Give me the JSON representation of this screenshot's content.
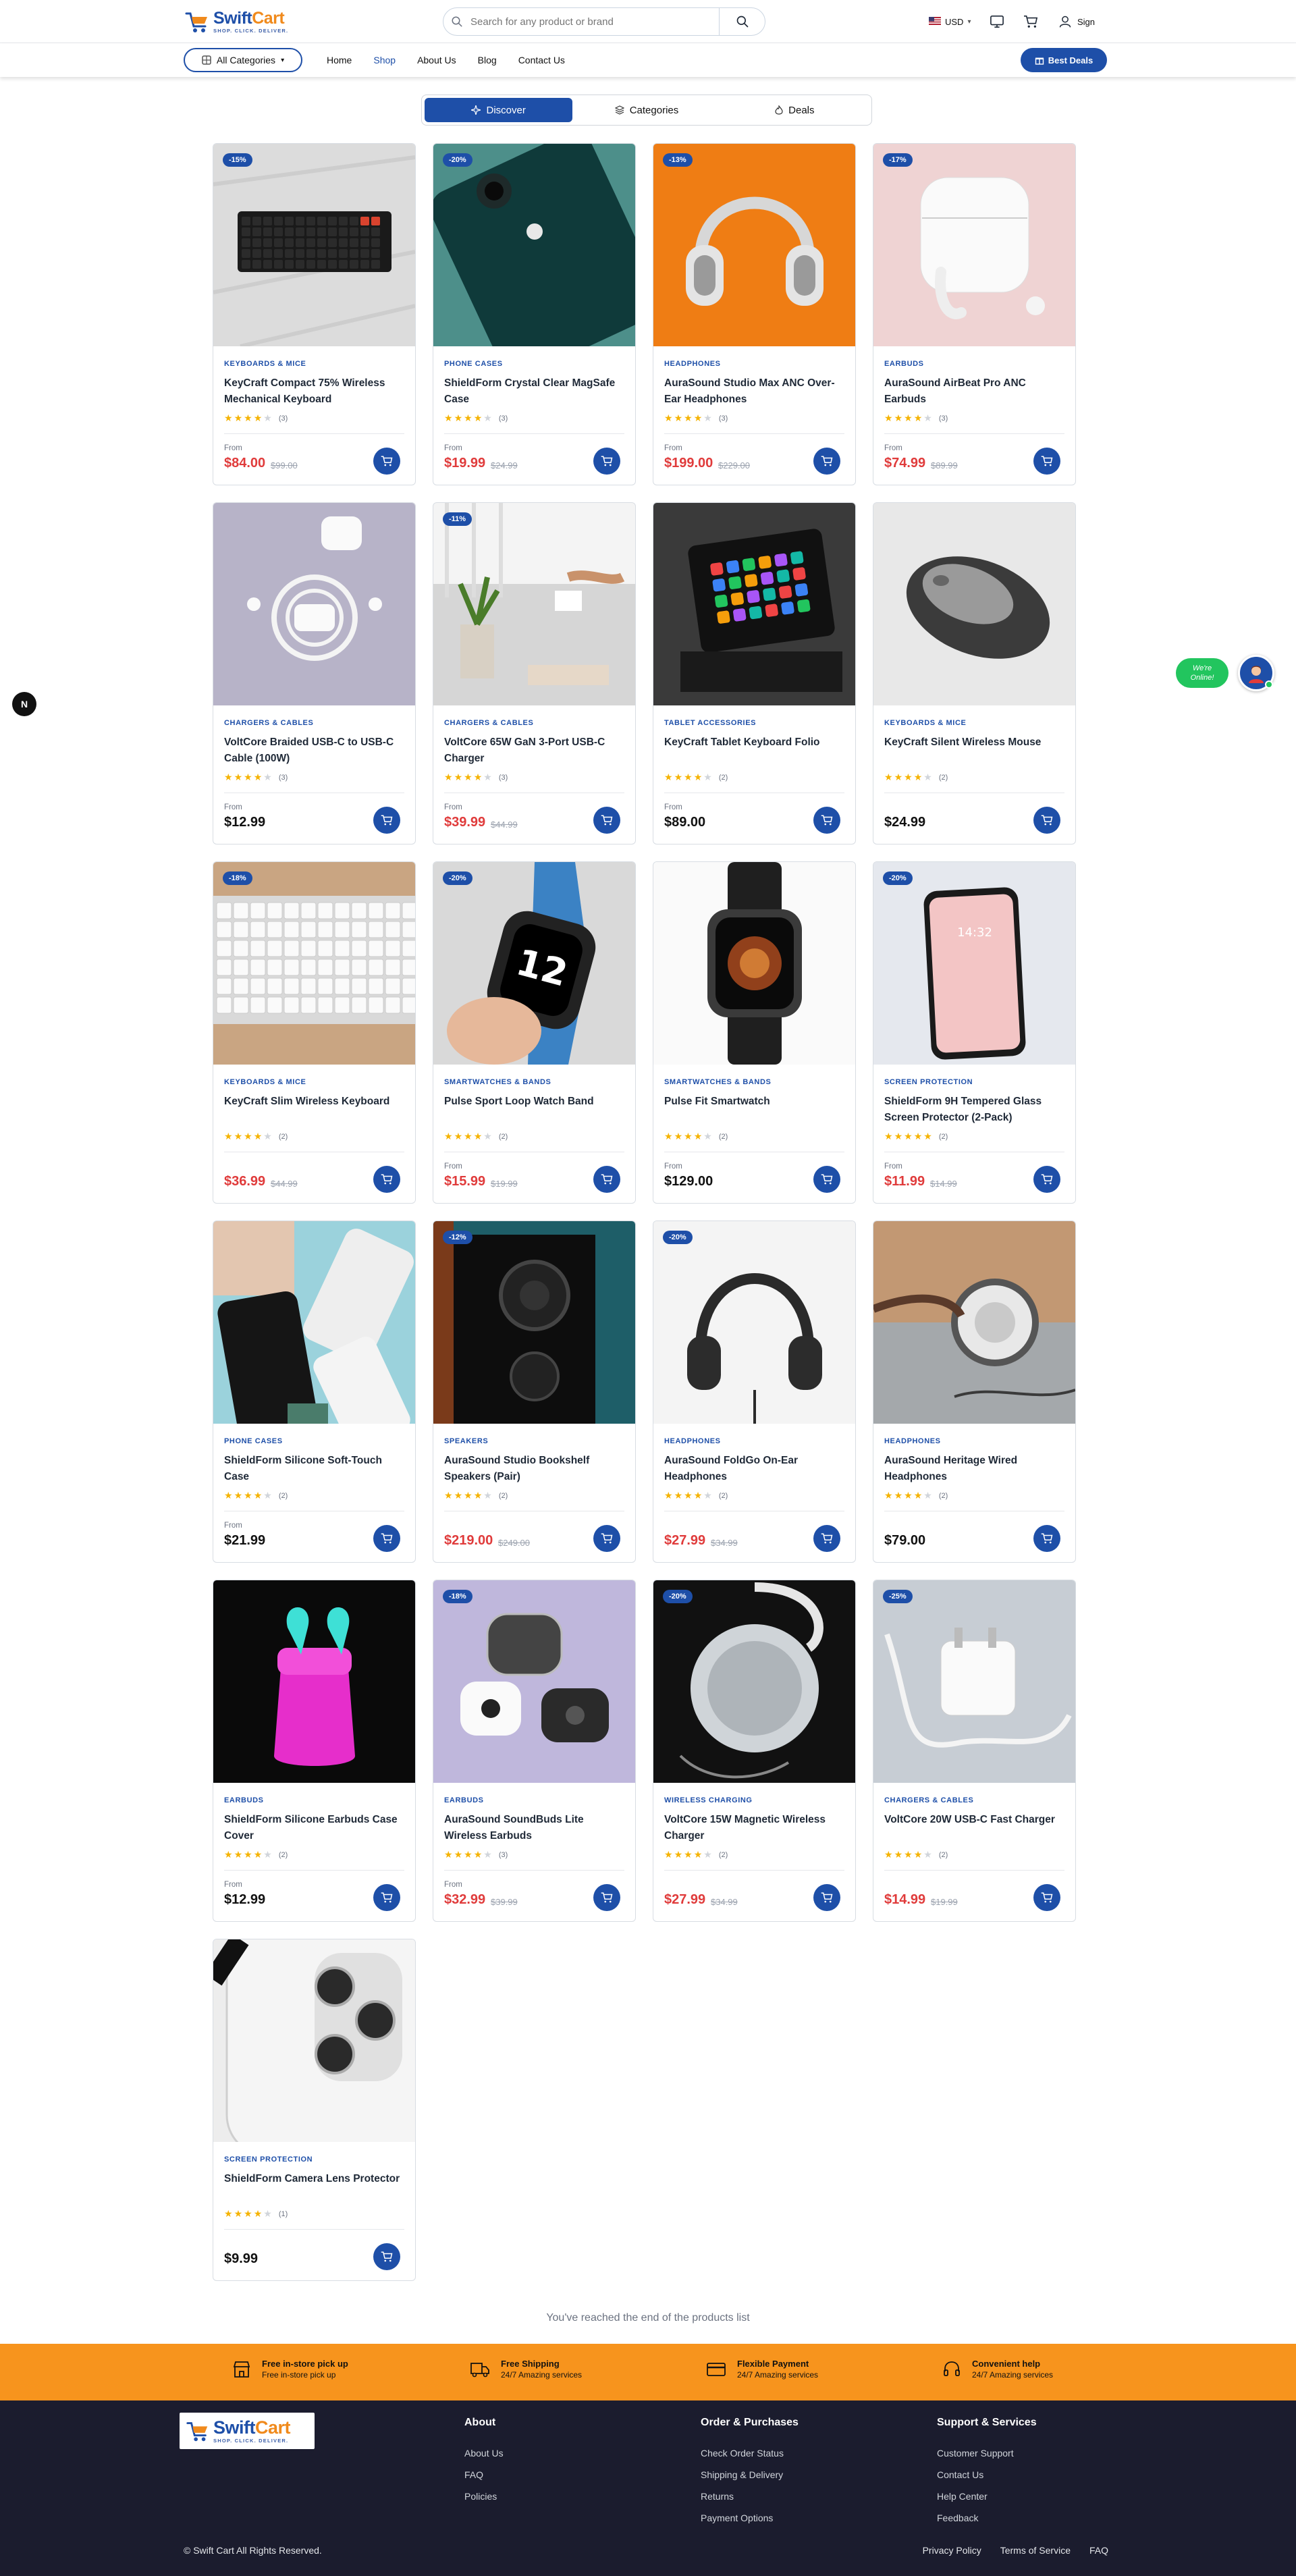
{
  "brand": {
    "name_part1": "Swift",
    "name_part2": "Cart",
    "tagline": "SHOP. CLICK. DELIVER."
  },
  "search": {
    "placeholder": "Search for any product or brand"
  },
  "header": {
    "currency": "USD",
    "sign_label": "Sign"
  },
  "nav": {
    "all_categories": "All Categories",
    "links": [
      "Home",
      "Shop",
      "About Us",
      "Blog",
      "Contact Us"
    ],
    "active": "Shop",
    "best_deals": "Best Deals"
  },
  "tabs": [
    "Discover",
    "Categories",
    "Deals"
  ],
  "products": [
    {
      "badge": "-15%",
      "category": "KEYBOARDS & MICE",
      "name": "KeyCraft Compact 75% Wireless Mechanical Keyboard",
      "rating": 4,
      "reviews": "(3)",
      "from": "From",
      "price": "$84.00",
      "old": "$99.00",
      "image": "keyboard-compact"
    },
    {
      "badge": "-20%",
      "category": "PHONE CASES",
      "name": "ShieldForm Crystal Clear MagSafe Case",
      "rating": 4,
      "reviews": "(3)",
      "from": "From",
      "price": "$19.99",
      "old": "$24.99",
      "image": "phone-case-green"
    },
    {
      "badge": "-13%",
      "category": "HEADPHONES",
      "name": "AuraSound Studio Max ANC Over-Ear Headphones",
      "rating": 4,
      "reviews": "(3)",
      "from": "From",
      "price": "$199.00",
      "old": "$229.00",
      "image": "headphones-orange"
    },
    {
      "badge": "-17%",
      "category": "EARBUDS",
      "name": "AuraSound AirBeat Pro ANC Earbuds",
      "rating": 4,
      "reviews": "(3)",
      "from": "From",
      "price": "$74.99",
      "old": "$89.99",
      "image": "earbuds-pink"
    },
    {
      "badge": "",
      "category": "CHARGERS & CABLES",
      "name": "VoltCore Braided USB-C to USB-C Cable (100W)",
      "rating": 4,
      "reviews": "(3)",
      "from": "From",
      "price": "$12.99",
      "old": "",
      "image": "cable-lavender"
    },
    {
      "badge": "-11%",
      "category": "CHARGERS & CABLES",
      "name": "VoltCore 65W GaN 3-Port USB-C Charger",
      "rating": 4,
      "reviews": "(3)",
      "from": "From",
      "price": "$39.99",
      "old": "$44.99",
      "image": "charger-desk"
    },
    {
      "badge": "",
      "category": "TABLET ACCESSORIES",
      "name": "KeyCraft Tablet Keyboard Folio",
      "rating": 4,
      "reviews": "(2)",
      "from": "From",
      "price": "$89.00",
      "old": "",
      "image": "tablet"
    },
    {
      "badge": "",
      "category": "KEYBOARDS & MICE",
      "name": "KeyCraft Silent Wireless Mouse",
      "rating": 4,
      "reviews": "(2)",
      "from": "",
      "price": "$24.99",
      "old": "",
      "image": "mouse"
    },
    {
      "badge": "-18%",
      "category": "KEYBOARDS & MICE",
      "name": "KeyCraft Slim Wireless Keyboard",
      "rating": 4,
      "reviews": "(2)",
      "from": "",
      "price": "$36.99",
      "old": "$44.99",
      "image": "keyboard-slim"
    },
    {
      "badge": "-20%",
      "category": "SMARTWATCHES & BANDS",
      "name": "Pulse Sport Loop Watch Band",
      "rating": 4,
      "reviews": "(2)",
      "from": "From",
      "price": "$15.99",
      "old": "$19.99",
      "image": "watch-band"
    },
    {
      "badge": "",
      "category": "SMARTWATCHES & BANDS",
      "name": "Pulse Fit Smartwatch",
      "rating": 4,
      "reviews": "(2)",
      "from": "From",
      "price": "$129.00",
      "old": "",
      "image": "smartwatch"
    },
    {
      "badge": "-20%",
      "category": "SCREEN PROTECTION",
      "name": "ShieldForm 9H Tempered Glass Screen Protector (2-Pack)",
      "rating": 5,
      "reviews": "(2)",
      "from": "From",
      "price": "$11.99",
      "old": "$14.99",
      "image": "phone-screen"
    },
    {
      "badge": "",
      "category": "PHONE CASES",
      "name": "ShieldForm Silicone Soft-Touch Case",
      "rating": 4,
      "reviews": "(2)",
      "from": "From",
      "price": "$21.99",
      "old": "",
      "image": "phones-blue"
    },
    {
      "badge": "-12%",
      "category": "SPEAKERS",
      "name": "AuraSound Studio Bookshelf Speakers (Pair)",
      "rating": 4,
      "reviews": "(2)",
      "from": "",
      "price": "$219.00",
      "old": "$249.00",
      "image": "speaker"
    },
    {
      "badge": "-20%",
      "category": "HEADPHONES",
      "name": "AuraSound FoldGo On-Ear Headphones",
      "rating": 4,
      "reviews": "(2)",
      "from": "",
      "price": "$27.99",
      "old": "$34.99",
      "image": "headphones-black"
    },
    {
      "badge": "",
      "category": "HEADPHONES",
      "name": "AuraSound Heritage Wired Headphones",
      "rating": 4,
      "reviews": "(2)",
      "from": "",
      "price": "$79.00",
      "old": "",
      "image": "headphones-wired"
    },
    {
      "badge": "",
      "category": "EARBUDS",
      "name": "ShieldForm Silicone Earbuds Case Cover",
      "rating": 4,
      "reviews": "(2)",
      "from": "From",
      "price": "$12.99",
      "old": "",
      "image": "earbuds-neon"
    },
    {
      "badge": "-18%",
      "category": "EARBUDS",
      "name": "AuraSound SoundBuds Lite Wireless Earbuds",
      "rating": 4,
      "reviews": "(3)",
      "from": "From",
      "price": "$32.99",
      "old": "$39.99",
      "image": "earbuds-lavender"
    },
    {
      "badge": "-20%",
      "category": "WIRELESS CHARGING",
      "name": "VoltCore 15W Magnetic Wireless Charger",
      "rating": 4,
      "reviews": "(2)",
      "from": "",
      "price": "$27.99",
      "old": "$34.99",
      "image": "magsafe"
    },
    {
      "badge": "-25%",
      "category": "CHARGERS & CABLES",
      "name": "VoltCore 20W USB-C Fast Charger",
      "rating": 4,
      "reviews": "(2)",
      "from": "",
      "price": "$14.99",
      "old": "$19.99",
      "image": "charger-white"
    },
    {
      "badge": "",
      "category": "SCREEN PROTECTION",
      "name": "ShieldForm Camera Lens Protector",
      "rating": 4,
      "reviews": "(1)",
      "from": "",
      "price": "$9.99",
      "old": "",
      "image": "camera-lens"
    }
  ],
  "end_message": "You've reached the end of the products list",
  "features": [
    {
      "title": "Free in-store pick up",
      "subtitle": "Free in-store pick up",
      "icon": "store-icon"
    },
    {
      "title": "Free Shipping",
      "subtitle": "24/7 Amazing services",
      "icon": "truck-icon"
    },
    {
      "title": "Flexible Payment",
      "subtitle": "24/7 Amazing services",
      "icon": "card-icon"
    },
    {
      "title": "Convenient help",
      "subtitle": "24/7 Amazing services",
      "icon": "headset-icon"
    }
  ],
  "footer": {
    "columns": [
      {
        "title": "About",
        "links": [
          "About Us",
          "FAQ",
          "Policies"
        ]
      },
      {
        "title": "Order & Purchases",
        "links": [
          "Check Order Status",
          "Shipping & Delivery",
          "Returns",
          "Payment Options"
        ]
      },
      {
        "title": "Support & Services",
        "links": [
          "Customer Support",
          "Contact Us",
          "Help Center",
          "Feedback"
        ]
      }
    ],
    "copyright": "© Swift Cart All Rights Reserved.",
    "bottom_links": [
      "Privacy Policy",
      "Terms of Service",
      "FAQ"
    ]
  },
  "floating": {
    "left_badge": "N",
    "online_line1": "We're",
    "online_line2": "Online!"
  },
  "colors": {
    "primary": "#1e4fa8",
    "accent": "#f7941d",
    "sale": "#e03b3b",
    "star": "#f5b301",
    "footer": "#1b1c2e",
    "online": "#22c55e"
  }
}
